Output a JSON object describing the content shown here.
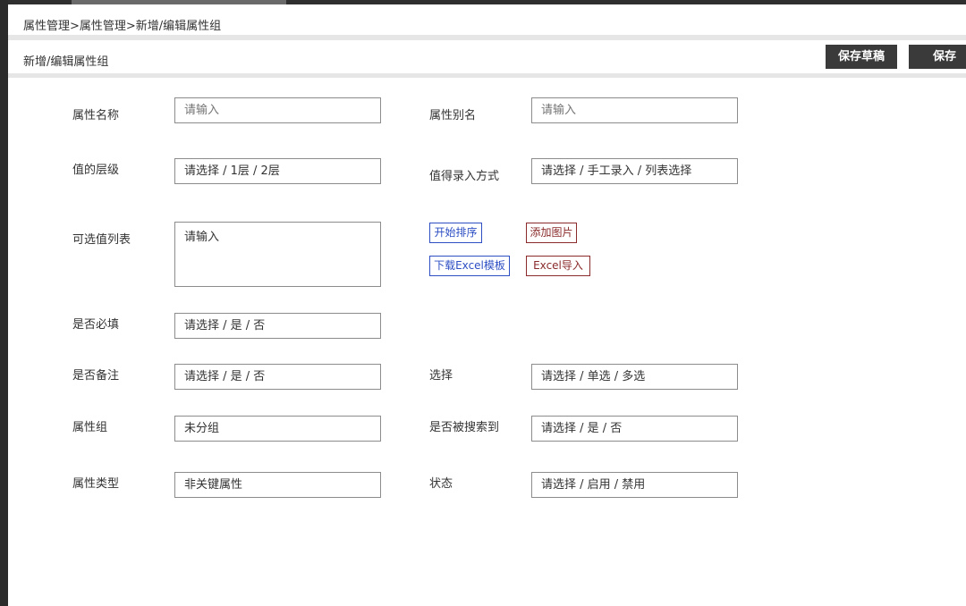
{
  "breadcrumb": "属性管理>属性管理>新增/编辑属性组",
  "page_title": "新增/编辑属性组",
  "buttons": {
    "save_draft": "保存草稿",
    "save": "保存"
  },
  "form": {
    "attr_name": {
      "label": "属性名称",
      "placeholder": "请输入"
    },
    "attr_alias": {
      "label": "属性别名",
      "placeholder": "请输入"
    },
    "value_level": {
      "label": "值的层级",
      "value": "请选择 / 1层 / 2层"
    },
    "entry_method": {
      "label": "值得录入方式",
      "value": "请选择 / 手工录入 / 列表选择"
    },
    "option_list": {
      "label": "可选值列表",
      "placeholder": "请输入"
    },
    "required": {
      "label": "是否必填",
      "value": "请选择 / 是 / 否"
    },
    "remark": {
      "label": "是否备注",
      "value": "请选择 / 是 / 否"
    },
    "selection": {
      "label": "选择",
      "value": "请选择 / 单选 / 多选"
    },
    "attr_group": {
      "label": "属性组",
      "value": "未分组"
    },
    "searchable": {
      "label": "是否被搜索到",
      "value": "请选择 / 是 / 否"
    },
    "attr_type": {
      "label": "属性类型",
      "value": "非关键属性"
    },
    "status": {
      "label": "状态",
      "value": "请选择 / 启用 / 禁用"
    }
  },
  "list_actions": {
    "start_sort": "开始排序",
    "add_image": "添加图片",
    "download_template": "下载Excel模板",
    "excel_import": "Excel导入"
  },
  "colors": {
    "dark_button": "#3a3a3a",
    "blue_action": "#2e4fc4",
    "red_action": "#8a2a2a"
  }
}
